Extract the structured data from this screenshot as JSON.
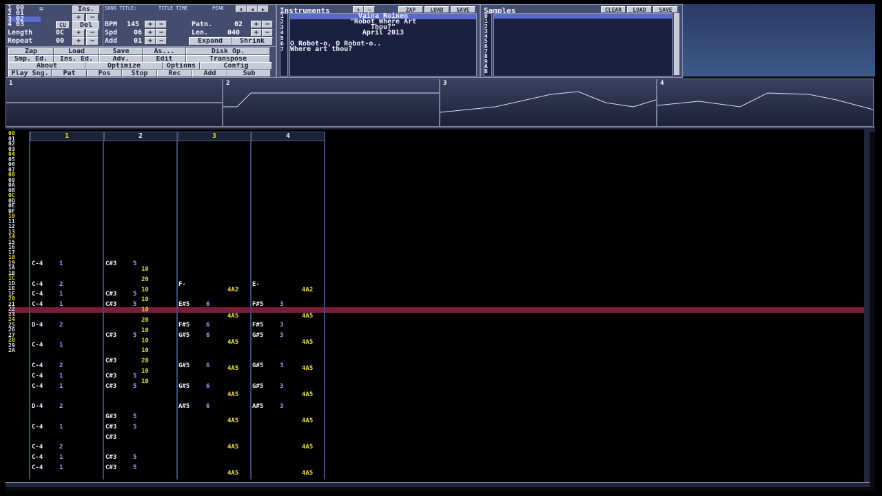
{
  "position": {
    "rows": [
      "1 00",
      "2 01",
      "3 02",
      "4 03"
    ],
    "ins_button": "Ins.",
    "del_button": "Del",
    "cu_button": "CU",
    "length_label": "Length",
    "length_value": "0C",
    "repeat_label": "Repeat",
    "repeat_value": "00"
  },
  "song": {
    "title_label": "SONG TITLE:",
    "title_value": "TITLE TIME",
    "peak_label": "PEAK",
    "bpm_label": "BPM",
    "bpm_value": "145",
    "spd_label": "Spd",
    "spd_value": "06",
    "add_label": "Add",
    "add_value": "01",
    "patn_label": "Patn.",
    "patn_value": "02",
    "len_label": "Len.",
    "len_value": "040",
    "expand": "Expand",
    "shrink": "Shrink"
  },
  "menu": [
    [
      "Zap",
      "Load",
      "Save",
      "As...",
      "Disk Op."
    ],
    [
      "Smp. Ed.",
      "Ins. Ed.",
      "Adv.",
      "Edit",
      "Transpose"
    ],
    [
      "About",
      "Optimize",
      "Options",
      "Config"
    ],
    [
      "Play Sng.",
      "Pat",
      "Pos",
      "Stop",
      "Rec",
      "Add",
      "Sub"
    ]
  ],
  "instruments": {
    "title": "Instruments",
    "zap": "ZAP",
    "load": "LOAD",
    "save": "SAVE",
    "numbers": [
      "1",
      "2",
      "3",
      "4",
      "5",
      "6",
      "7"
    ],
    "lines": [
      "Vaina Roinen",
      "\"Robot Where Art",
      "Thou?\"",
      "April 2013",
      "",
      "O Robot-o, O Robot-o..",
      "Where art thou?"
    ]
  },
  "samples": {
    "title": "Samples",
    "clear": "CLEAR",
    "load": "LOAD",
    "save": "SAVE",
    "numbers": [
      "0",
      "1",
      "2",
      "3",
      "4",
      "5",
      "6",
      "7",
      "8",
      "9",
      "A",
      "B"
    ]
  },
  "scopes": [
    "1",
    "2",
    "3",
    "4"
  ],
  "channels": [
    "1",
    "2",
    "3",
    "4"
  ],
  "row_numbers": [
    "00",
    "01",
    "02",
    "03",
    "04",
    "05",
    "06",
    "07",
    "08",
    "09",
    "0A",
    "0B",
    "0C",
    "0D",
    "0E",
    "0F",
    "10",
    "11",
    "12",
    "13",
    "14",
    "15",
    "16",
    "17",
    "18",
    "19",
    "1A",
    "1B",
    "1C",
    "1D",
    "1E",
    "1F",
    "20",
    "21",
    "22",
    "23",
    "24",
    "25",
    "26",
    "27",
    "28",
    "29",
    "2A"
  ],
  "pattern_rows": [
    {
      "row": 0,
      "c1": "C-4 1",
      "c2": "C#3 5",
      "c3": "",
      "c4": ""
    },
    {
      "row": 4,
      "c1": "C-4 2",
      "c2": "",
      "c3": "F-",
      "c4": "E-"
    },
    {
      "row": 6,
      "c1": "C-4 1",
      "c2": "C#3 5",
      "c3": "",
      "c4": ""
    },
    {
      "row": 8,
      "c1": "C-4 1",
      "c2": "C#3 5",
      "c3": "E#5 6",
      "c4": "F#5 3"
    },
    {
      "row": 12,
      "c1": "D-4 2",
      "c2": "",
      "c3": "F#5 6",
      "c4": "F#5 3"
    },
    {
      "row": 14,
      "c1": "",
      "c2": "C#3 5",
      "c3": "G#5 6",
      "c4": "G#5 3"
    },
    {
      "row": 16,
      "c1": "C-4 1",
      "c2": "",
      "c3": "",
      "c4": ""
    },
    {
      "row": 19,
      "c1": "",
      "c2": "C#3",
      "c3": "",
      "c4": ""
    },
    {
      "row": 20,
      "c1": "C-4 2",
      "c2": "",
      "c3": "G#5 6",
      "c4": "G#5 3"
    },
    {
      "row": 22,
      "c1": "C-4 1",
      "c2": "C#3 5",
      "c3": "",
      "c4": ""
    },
    {
      "row": 24,
      "c1": "C-4 1",
      "c2": "C#3 5",
      "c3": "G#5 6",
      "c4": "G#5 3"
    },
    {
      "row": 28,
      "c1": "D-4 2",
      "c2": "",
      "c3": "A#5 6",
      "c4": "A#5 3"
    },
    {
      "row": 30,
      "c1": "",
      "c2": "G#3 5",
      "c3": "",
      "c4": ""
    },
    {
      "row": 32,
      "c1": "C-4 1",
      "c2": "C#3 5",
      "c3": "",
      "c4": ""
    },
    {
      "row": 34,
      "c1": "",
      "c2": "C#3",
      "c3": "",
      "c4": ""
    },
    {
      "row": 36,
      "c1": "C-4 2",
      "c2": "",
      "c3": "",
      "c4": ""
    },
    {
      "row": 38,
      "c1": "C-4 1",
      "c2": "C#3 5",
      "c3": "",
      "c4": ""
    },
    {
      "row": 40,
      "c1": "C-4 1",
      "c2": "C#3 5",
      "c3": "",
      "c4": ""
    }
  ],
  "vol_column": [
    "10",
    "20",
    "10",
    "10",
    "10",
    "20",
    "10",
    "10",
    "10",
    "20",
    "10",
    "10"
  ],
  "fx_column": [
    "4A2",
    "4A5",
    "4A5",
    "4A5",
    "4A5",
    "4A5",
    "4A5",
    "4A5"
  ]
}
